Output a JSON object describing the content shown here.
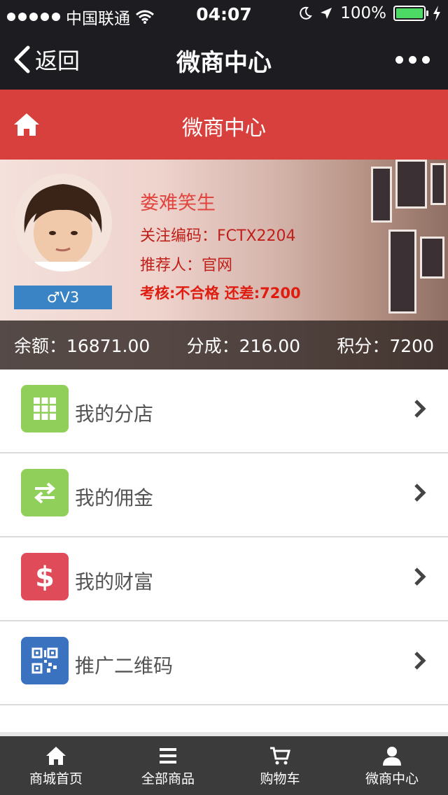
{
  "status": {
    "carrier": "中国联通",
    "time": "04:07",
    "battery": "100%"
  },
  "nav": {
    "back_label": "返回",
    "title": "微商中心"
  },
  "header": {
    "title": "微商中心"
  },
  "profile": {
    "name": "娄难笑生",
    "follow_code": "关注编码：FCTX2204",
    "referrer": "推荐人：官网",
    "assessment": "考核:不合格 还差:7200",
    "level": "♂V3"
  },
  "stats": {
    "balance": "余额：16871.00",
    "commission": "分成：216.00",
    "points": "积分：7200"
  },
  "menu": [
    {
      "label": "我的分店",
      "icon": "grid-icon",
      "color": "#8fcf5a"
    },
    {
      "label": "我的佣金",
      "icon": "exchange-icon",
      "color": "#8fcf5a"
    },
    {
      "label": "我的财富",
      "icon": "dollar-icon",
      "color": "#e04b5a"
    },
    {
      "label": "推广二维码",
      "icon": "qrcode-icon",
      "color": "#3a72c0"
    }
  ],
  "tabs": [
    {
      "label": "商城首页",
      "icon": "home-icon"
    },
    {
      "label": "全部商品",
      "icon": "list-icon"
    },
    {
      "label": "购物车",
      "icon": "cart-icon"
    },
    {
      "label": "微商中心",
      "icon": "user-icon"
    }
  ]
}
